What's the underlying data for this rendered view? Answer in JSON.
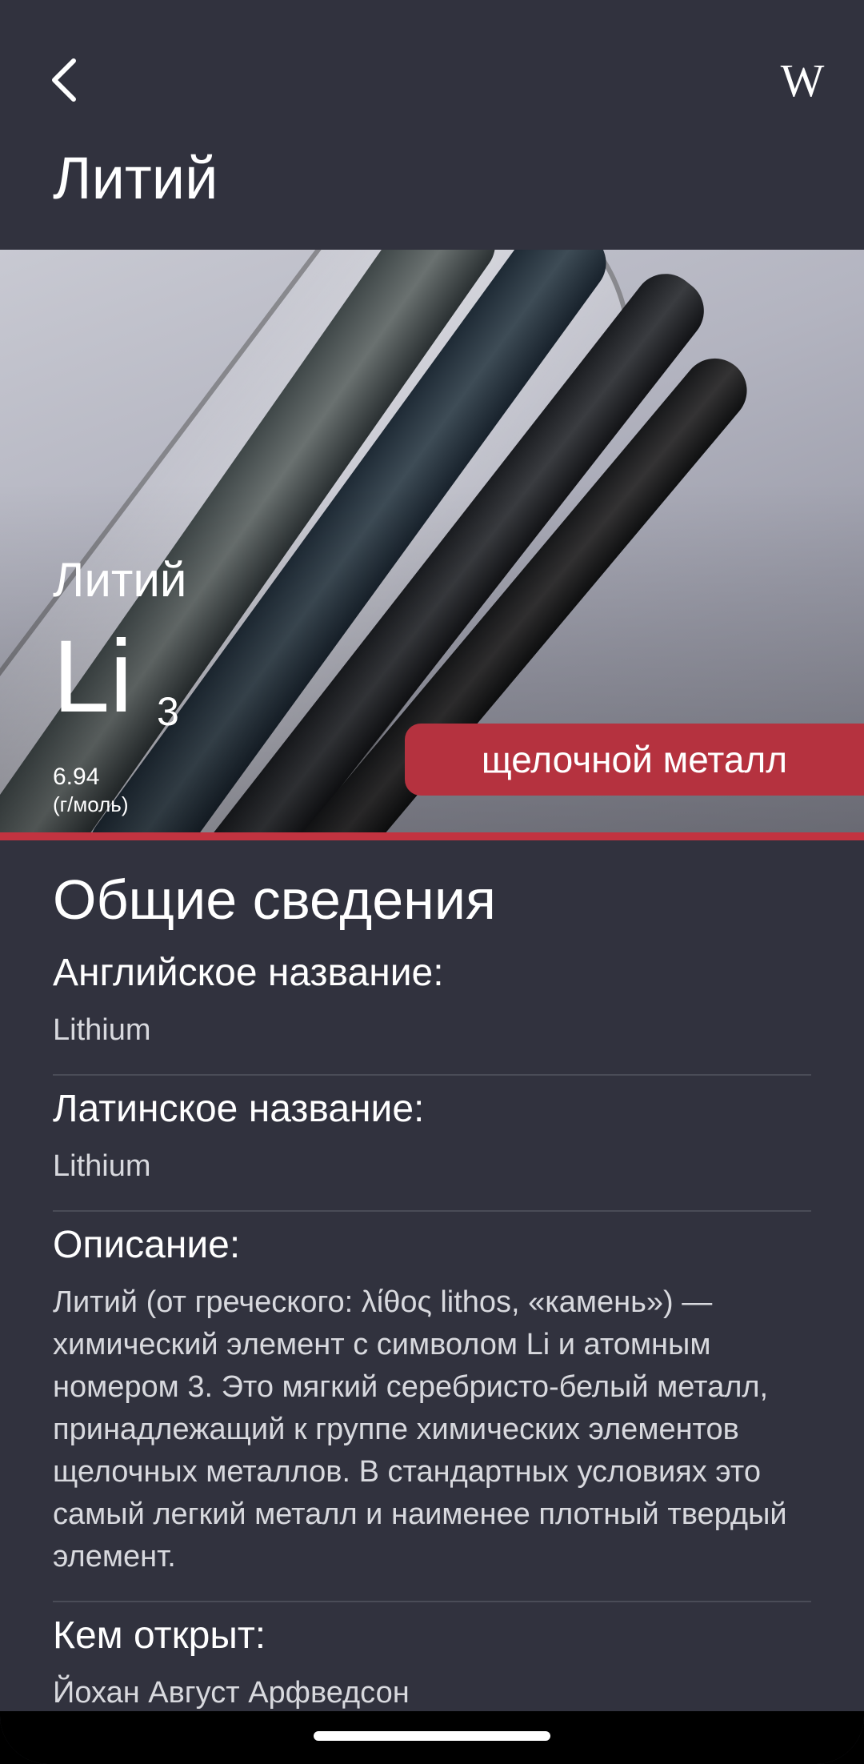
{
  "header": {
    "title": "Литий",
    "back_icon": "chevron-left-icon",
    "wiki_icon": "wikipedia-icon",
    "wiki_glyph": "W"
  },
  "hero": {
    "name": "Литий",
    "symbol": "Li",
    "atomic_number": "3",
    "atomic_mass": "6.94",
    "mass_unit": "(г/моль)",
    "category": "щелочной металл",
    "category_color": "#b5323f"
  },
  "info": {
    "section_title": "Общие сведения",
    "items": [
      {
        "label": "Английское название:",
        "value": "Lithium"
      },
      {
        "label": "Латинское название:",
        "value": "Lithium"
      },
      {
        "label": "Описание:",
        "value": "Литий (от греческого: λίθος lithos, «камень») — химический элемент с символом Li и атомным номером 3. Это мягкий серебристо-белый металл, принадлежащий к группе химических элементов щелочных металлов. В стандартных условиях это самый легкий металл и наименее плотный твердый элемент."
      },
      {
        "label": "Кем открыт:",
        "value": "Йохан Август Арфведсон"
      }
    ]
  }
}
